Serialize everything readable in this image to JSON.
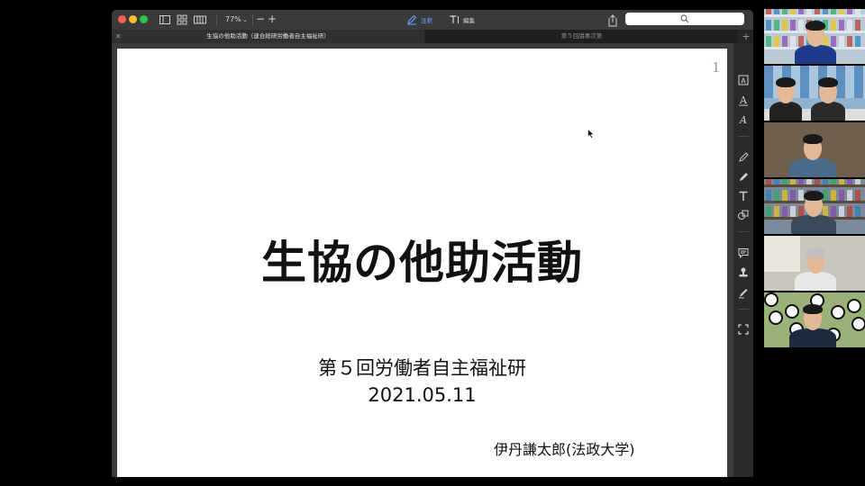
{
  "toolbar": {
    "zoom_value": "77%",
    "zoom_out_label": "−",
    "zoom_in_label": "+",
    "annotate_label": "注釈",
    "edit_label": "編集",
    "search_placeholder": ""
  },
  "tabs": [
    {
      "label": "生協の他助活動（連合総研労働者自主福祉研）",
      "active": true
    },
    {
      "label": "第５回議事次第",
      "active": false
    }
  ],
  "document": {
    "page_number": "1",
    "title": "生協の他助活動",
    "subtitle_line1": "第５回労働者自主福祉研",
    "subtitle_line2": "2021.05.11",
    "author": "伊丹謙太郎(法政大学)"
  },
  "right_toolbar_icons": [
    "text-select-icon",
    "text-style-icon",
    "text-color-icon",
    "pencil-icon",
    "eraser-icon",
    "text-box-icon",
    "shapes-icon",
    "comment-icon",
    "stamp-icon",
    "signature-icon",
    "crop-icon"
  ],
  "video_participants": [
    {
      "name": "participant-1",
      "bg": "#b9c9d6"
    },
    {
      "name": "participant-2",
      "bg": "#8fb3cf"
    },
    {
      "name": "participant-3",
      "bg": "#6f5f4f"
    },
    {
      "name": "participant-4",
      "bg": "#7a8a9a"
    },
    {
      "name": "participant-5",
      "bg": "#c9c6bd"
    },
    {
      "name": "participant-6",
      "bg": "#9ab27a"
    }
  ]
}
